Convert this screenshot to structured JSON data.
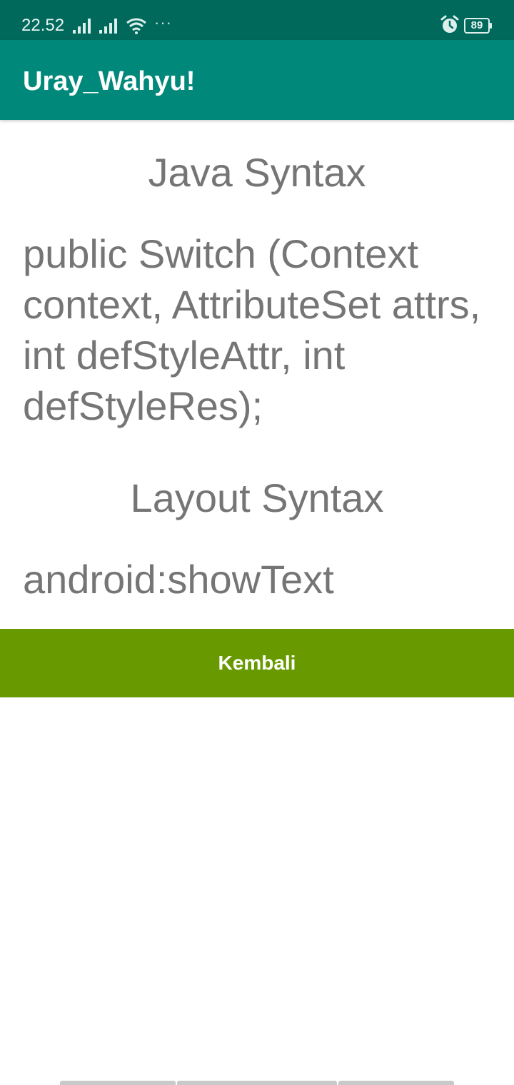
{
  "status_bar": {
    "time": "22.52",
    "more_label": "···",
    "battery_level": "89",
    "icons": [
      "signal-icon",
      "signal-icon",
      "wifi-icon",
      "alarm-icon",
      "battery-icon"
    ]
  },
  "app_bar": {
    "title": "Uray_Wahyu!",
    "color": "#00897b"
  },
  "sections": {
    "java_heading": "Java Syntax",
    "java_body": "public Switch (Context context, AttributeSet attrs, int defStyleAttr, int defStyleRes);",
    "layout_heading": "Layout Syntax",
    "layout_body": "android:showText"
  },
  "button": {
    "label": "Kembali",
    "color": "#689a00"
  }
}
